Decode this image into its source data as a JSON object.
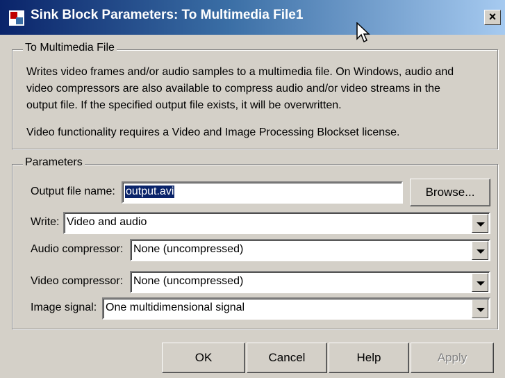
{
  "window": {
    "title": "Sink Block Parameters: To Multimedia File1",
    "close_glyph": "×"
  },
  "description": {
    "group_label": "To Multimedia File",
    "text_line1": "Writes video frames and/or audio samples to a multimedia file. On Windows, audio and",
    "text_line2": "video compressors are also available to compress audio and/or video streams in the",
    "text_line3": "output file. If the specified output file exists, it will be overwritten.",
    "text_line4": "Video functionality requires a Video and Image Processing Blockset license."
  },
  "parameters": {
    "group_label": "Parameters",
    "output_file_label": "Output file name:",
    "output_file_value": "output.avi",
    "browse_label": "Browse...",
    "write_label": "Write:",
    "write_value": "Video and audio",
    "audio_compressor_label": "Audio compressor:",
    "audio_compressor_value": "None (uncompressed)",
    "video_compressor_label": "Video compressor:",
    "video_compressor_value": "None (uncompressed)",
    "image_signal_label": "Image signal:",
    "image_signal_value": "One multidimensional signal"
  },
  "buttons": {
    "ok": "OK",
    "cancel": "Cancel",
    "help": "Help",
    "apply": "Apply"
  }
}
